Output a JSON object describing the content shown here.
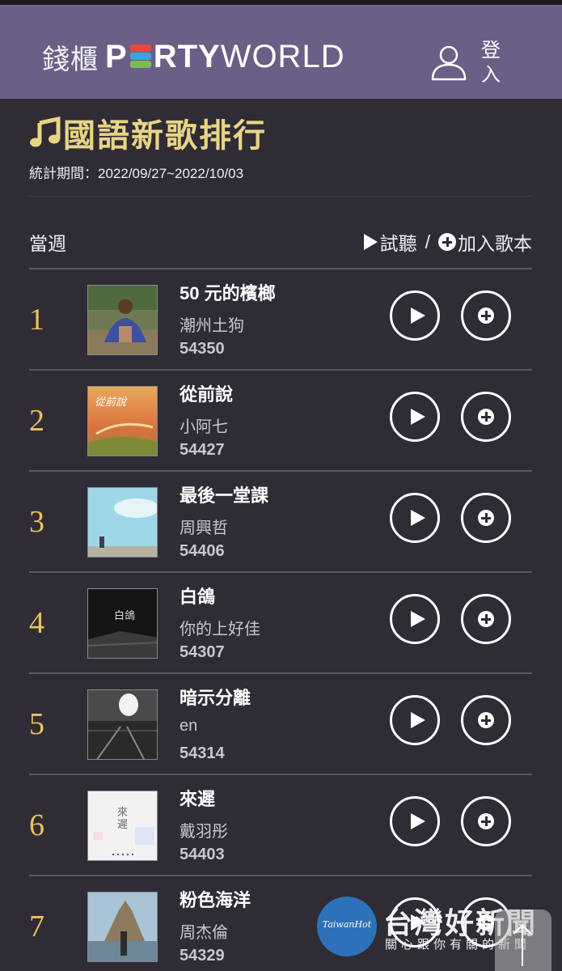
{
  "header": {
    "logo_cn": "錢櫃",
    "logo_party_p": "P",
    "logo_party_rest": "RTY",
    "logo_world": "WORLD",
    "login_label": "登入",
    "brand_colors": [
      "#e8473c",
      "#39a7dd",
      "#78bd4c"
    ]
  },
  "page": {
    "title": "國語新歌排行",
    "period": "統計期間：2022/09/27~2022/10/03",
    "week_label": "當週",
    "legend_listen": "試聽",
    "legend_slash": "/",
    "legend_add": "加入歌本"
  },
  "songs": [
    {
      "rank": "1",
      "title": "50 元的檳榔",
      "artist": "潮州土狗",
      "code": "54350"
    },
    {
      "rank": "2",
      "title": "從前說",
      "artist": "小阿七",
      "code": "54427"
    },
    {
      "rank": "3",
      "title": "最後一堂課",
      "artist": "周興哲",
      "code": "54406"
    },
    {
      "rank": "4",
      "title": "白鴿",
      "artist": "你的上好佳",
      "code": "54307"
    },
    {
      "rank": "5",
      "title": "暗示分離",
      "artist": "en",
      "code": "54314"
    },
    {
      "rank": "6",
      "title": "來遲",
      "artist": "戴羽彤",
      "code": "54403"
    },
    {
      "rank": "7",
      "title": "粉色海洋",
      "artist": "周杰倫",
      "code": "54329"
    }
  ],
  "covers": {
    "c1": "從前說",
    "c4": "白鴿",
    "c6": "來遲"
  },
  "watermark": {
    "script": "TaiwanHot",
    "big": "台灣好新聞",
    "small": "關心跟你有關的新聞"
  },
  "colors": {
    "header": "#6b5f86",
    "background": "#2f2c36",
    "title": "#e8d584",
    "rank": "#e8c35a"
  }
}
